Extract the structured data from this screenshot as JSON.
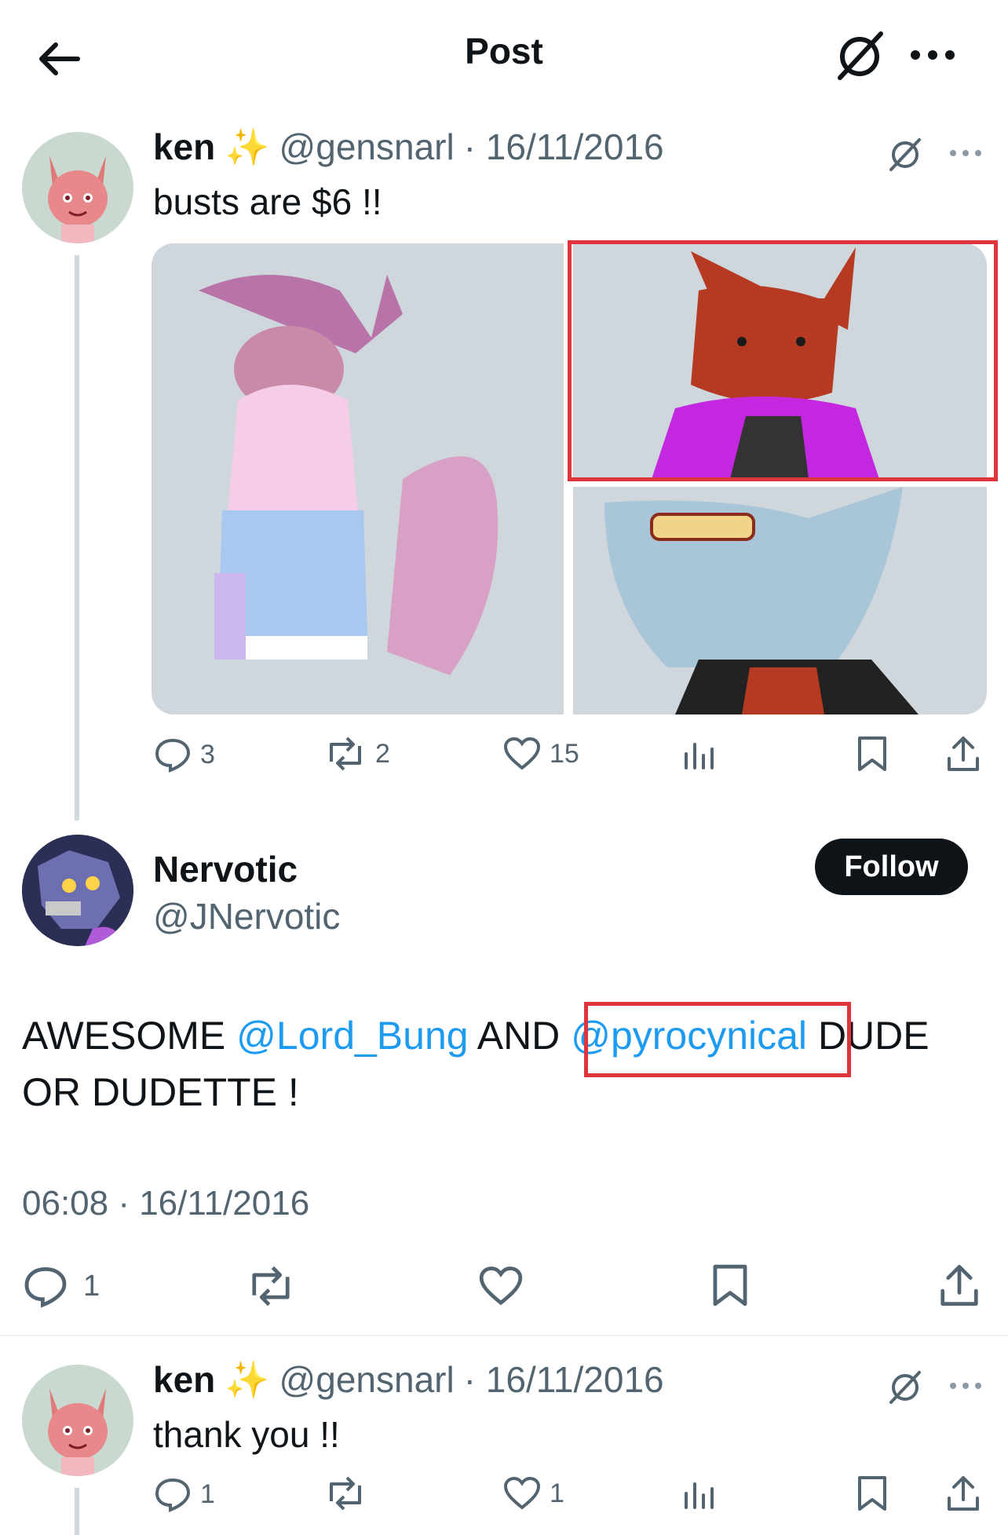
{
  "header": {
    "title": "Post"
  },
  "post1": {
    "name": "ken",
    "emoji": "✨",
    "handle": "@gensnarl",
    "date": "· 16/11/2016",
    "text": "busts are $6 !!",
    "replies": "3",
    "reposts": "2",
    "likes": "15"
  },
  "post2": {
    "name": "Nervotic",
    "handle": "@JNervotic",
    "follow_label": "Follow",
    "text_a": "AWESOME ",
    "mention1": "@Lord_Bung",
    "text_b": " AND ",
    "mention2": "@pyrocynical",
    "text_c": " DUDE OR DUDETTE !",
    "timestamp": "06:08 · 16/11/2016",
    "replies": "1"
  },
  "post3": {
    "name": "ken",
    "emoji": "✨",
    "handle": "@gensnarl",
    "date": "· 16/11/2016",
    "text": "thank you !!",
    "replies": "1",
    "likes": "1"
  },
  "colors": {
    "link": "#1d9bf0",
    "highlight": "#e0343c",
    "muted": "#536471"
  }
}
